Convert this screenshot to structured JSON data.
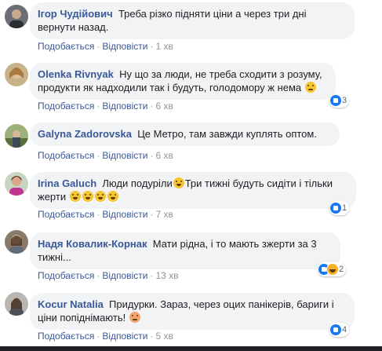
{
  "action_like": "Подобається",
  "action_reply": "Відповісти",
  "separator": "·",
  "colors": {
    "link": "#385898",
    "bubble": "#f2f3f5",
    "meta": "#90949c",
    "like": "#1877f2"
  },
  "comments": [
    {
      "author": "Ігор Чудійович",
      "text": "Треба різко підняти ціни а через три дні вернути назад.",
      "time": "1 хв",
      "reactions": null
    },
    {
      "author": "Olenka Rivnyak",
      "text": "Ну що за люди, не треба сходити з розуму, продукти як надходили так і будуть, голодомору ж нема",
      "emoji": "neutral-face-emoji",
      "time": "6 хв",
      "reactions": "3",
      "reaction_icons": [
        "like-icon"
      ]
    },
    {
      "author": "Galyna Zadorovska",
      "text": "Це Метро, там завжди куплять оптом.",
      "time": "6 хв",
      "reactions": null
    },
    {
      "author": "Irina Galuch",
      "text_a": "Люди подуріли",
      "emoji_a": "grinning-squinting-emoji",
      "text_b": "Три тижні будуть сидіти і тільки жерти",
      "emoji_b": [
        "screaming-face-emoji",
        "thinking-face-emoji",
        "rofl-emoji",
        "rofl-emoji"
      ],
      "time": "7 хв",
      "reactions": "1",
      "reaction_icons": [
        "like-icon"
      ]
    },
    {
      "author": "Надя Ковалик-Корнак",
      "text": "Мати рідна, і то мають зжерти за 3 тижні...",
      "time": "13 хв",
      "reactions": "2",
      "reaction_icons": [
        "like-icon",
        "haha-icon"
      ]
    },
    {
      "author": "Kocur Natalia",
      "text": "Придурки. Зараз, через оцих панікерів, бариги і ціни попіднімають!",
      "emoji": "angry-face-emoji",
      "time": "5 хв",
      "reactions": "4",
      "reaction_icons": [
        "like-icon"
      ]
    }
  ]
}
